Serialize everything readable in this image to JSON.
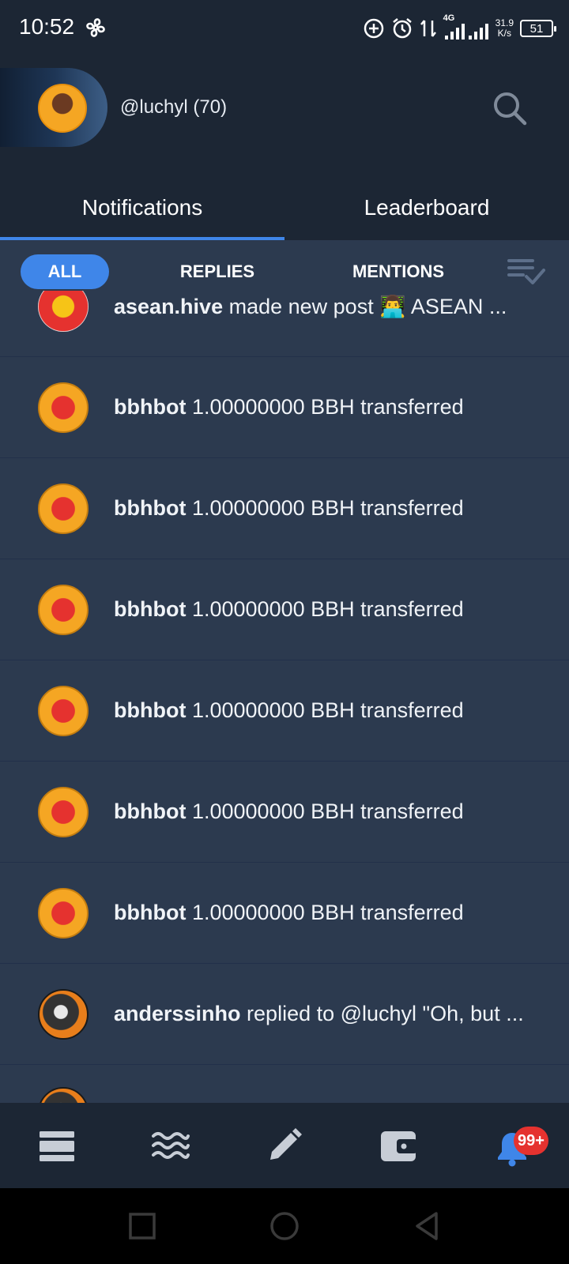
{
  "status_bar": {
    "time": "10:52",
    "network_type": "4G",
    "speed_value": "31.9",
    "speed_unit": "K/s",
    "battery": "51"
  },
  "header": {
    "username": "@luchyl (70)"
  },
  "tabs": [
    {
      "label": "Notifications",
      "active": true
    },
    {
      "label": "Leaderboard",
      "active": false
    }
  ],
  "filters": [
    {
      "label": "ALL",
      "active": true
    },
    {
      "label": "REPLIES",
      "active": false
    },
    {
      "label": "MENTIONS",
      "active": false
    }
  ],
  "notifications": [
    {
      "user": "asean.hive",
      "text": " made new post 👨‍💻 ASEAN ...",
      "avatar": "asean-avatar-icon"
    },
    {
      "user": "bbhbot",
      "text": " 1.00000000 BBH transferred",
      "avatar": "bbh-avatar-icon"
    },
    {
      "user": "bbhbot",
      "text": " 1.00000000 BBH transferred",
      "avatar": "bbh-avatar-icon"
    },
    {
      "user": "bbhbot",
      "text": " 1.00000000 BBH transferred",
      "avatar": "bbh-avatar-icon"
    },
    {
      "user": "bbhbot",
      "text": " 1.00000000 BBH transferred",
      "avatar": "bbh-avatar-icon"
    },
    {
      "user": "bbhbot",
      "text": " 1.00000000 BBH transferred",
      "avatar": "bbh-avatar-icon"
    },
    {
      "user": "bbhbot",
      "text": " 1.00000000 BBH transferred",
      "avatar": "bbh-avatar-icon"
    },
    {
      "user": "anderssinho",
      "text": " replied to @luchyl \"Oh, but ...",
      "avatar": "anders-avatar-icon"
    }
  ],
  "bottom_nav": {
    "items": [
      "feed-icon",
      "waves-icon",
      "pencil-icon",
      "wallet-icon",
      "bell-icon"
    ],
    "badge": "99+"
  },
  "colors": {
    "accent": "#3f86e9",
    "header_bg": "#1c2634",
    "list_bg": "#2c3a4f",
    "badge": "#e5322f"
  }
}
